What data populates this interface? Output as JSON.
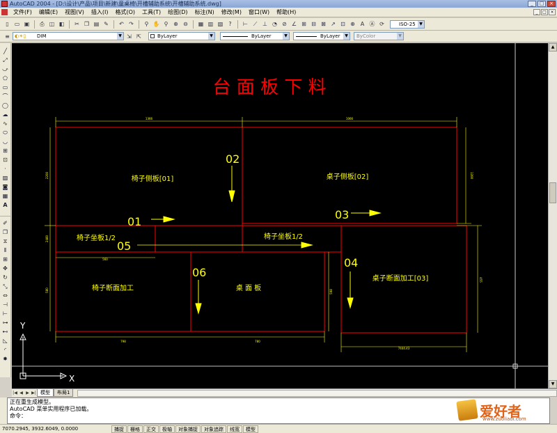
{
  "window": {
    "title": "AutoCAD 2004 - [D:\\设计\\产品\\项目\\新建\\童桌椅\\开槽辅助系统\\开槽辅助系统.dwg]",
    "buttons": [
      "_",
      "□",
      "×"
    ]
  },
  "menu": {
    "items": [
      "文件(F)",
      "编辑(E)",
      "视图(V)",
      "插入(I)",
      "格式(O)",
      "工具(T)",
      "绘图(D)",
      "标注(N)",
      "修改(M)",
      "窗口(W)",
      "帮助(H)"
    ]
  },
  "properties": {
    "layer": "DIM",
    "color": "ByLayer",
    "linetype": "ByLayer",
    "lineweight": "ByLayer",
    "plotstyle": "ByColor"
  },
  "drawing": {
    "title": "台 面 板 下 料",
    "colors": {
      "panel": "#ff0000",
      "dim": "#ffff00",
      "label": "#ffff00",
      "number": "#ffff00",
      "title": "#ff0000"
    },
    "panels": [
      {
        "label": "椅子侧板[01]"
      },
      {
        "label": "桌子侧板[02]"
      },
      {
        "label": "椅子坐板1/2"
      },
      {
        "label": "椅子坐板1/2"
      },
      {
        "label": "椅子断面加工"
      },
      {
        "label": "桌 面 板"
      },
      {
        "label": "桌子断面加工[03]"
      }
    ],
    "numbers": [
      "01",
      "02",
      "03",
      "04",
      "05",
      "06"
    ],
    "dims": [
      "1366",
      "1066",
      "2200",
      "1200",
      "560",
      "2480",
      "2200",
      "1220",
      "580",
      "598",
      "455",
      "798",
      "780",
      "7444.43"
    ],
    "axis": {
      "x": "X",
      "y": "Y"
    }
  },
  "tabs": [
    "模型",
    "布局1"
  ],
  "command": {
    "lines": [
      "正在重生成模型。",
      "AutoCAD 菜单实用程序已加载。",
      "命令："
    ]
  },
  "status": {
    "coords": "7070.2945, 3932.6049, 0.0000",
    "toggles": [
      "捕捉",
      "栅格",
      "正交",
      "极轴",
      "对象捕捉",
      "对象追踪",
      "线宽",
      "模型"
    ]
  },
  "logo": {
    "brand": "爱好者",
    "url": "www.zuoliaoi.com"
  }
}
